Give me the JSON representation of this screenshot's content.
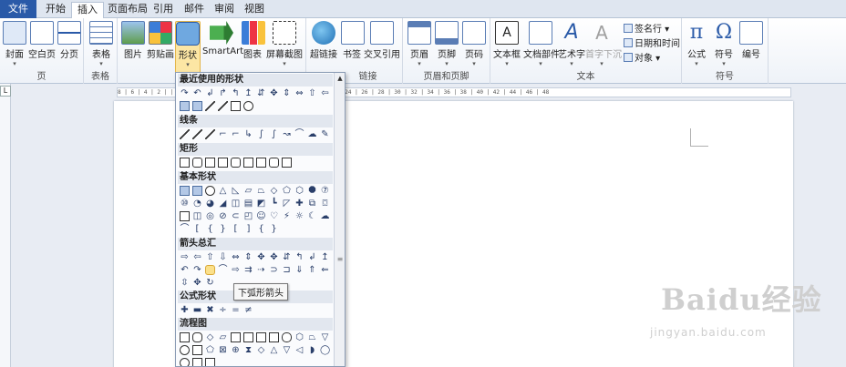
{
  "tabs": {
    "file": "文件",
    "items": [
      "开始",
      "插入",
      "页面布局",
      "引用",
      "邮件",
      "审阅",
      "视图"
    ],
    "active": "插入"
  },
  "ribbon": {
    "groups": {
      "pages": "页",
      "tables": "表格",
      "links": "链接",
      "header_footer": "页眉和页脚",
      "text": "文本",
      "symbols": "符号"
    },
    "buttons": {
      "cover": "封面",
      "blank_page": "空白页",
      "page_break": "分页",
      "table": "表格",
      "picture": "图片",
      "clipart": "剪贴画",
      "shapes": "形状",
      "smartart": "SmartArt",
      "chart": "图表",
      "screenshot": "屏幕截图",
      "hyperlink": "超链接",
      "bookmark": "书签",
      "cross_ref": "交叉引用",
      "header": "页眉",
      "footer": "页脚",
      "page_number": "页码",
      "textbox": "文本框",
      "quick_parts": "文档部件",
      "wordart": "艺术字",
      "dropcap": "首字下沉",
      "signature": "签名行",
      "datetime": "日期和时间",
      "object": "对象",
      "equation": "公式",
      "symbol": "符号",
      "number": "编号"
    },
    "equation_glyph": "π",
    "symbol_glyph": "Ω"
  },
  "ruler": {
    "corner": "L",
    "hticks": "8 | 6 | 4 | 2 | | 2 | 4 | 6 | 8 | 10 | 12 | 14 | 16 | 18 | 20 | 22 | 24 | 26 | 28 | 30 | 32 | 34 | 36 | 38 | 40 | 42 | 44 | 46 | 48"
  },
  "shapes_panel": {
    "sections": [
      "最近使用的形状",
      "线条",
      "矩形",
      "基本形状",
      "箭头总汇",
      "公式形状",
      "流程图"
    ],
    "tooltip": "下弧形箭头"
  },
  "watermark": {
    "brand": "Baidu经验",
    "url": "jingyan.baidu.com"
  }
}
